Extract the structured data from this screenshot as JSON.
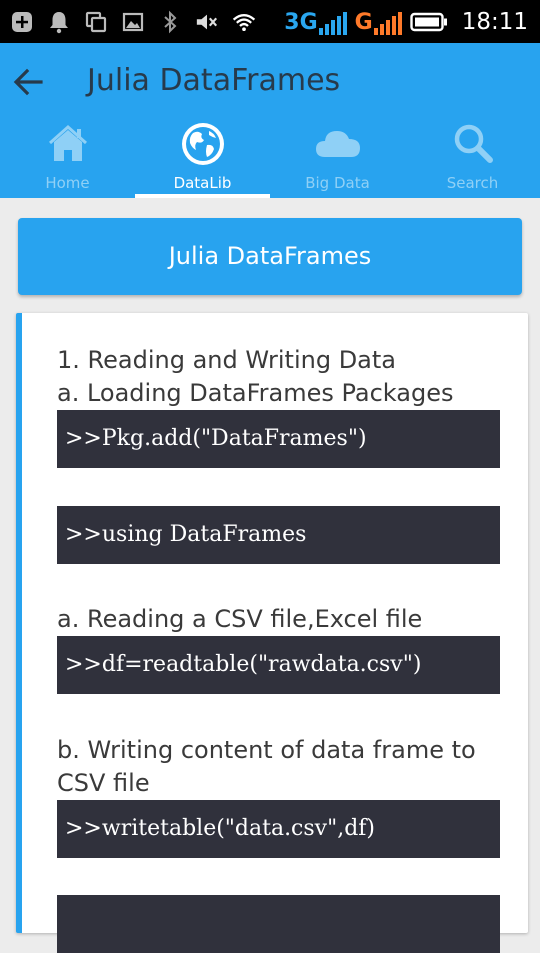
{
  "statusbar": {
    "net1": "3G",
    "net2": "G",
    "time": "18:11"
  },
  "appbar": {
    "title": "Julia DataFrames"
  },
  "tabs": [
    {
      "label": "Home",
      "icon": "home-icon",
      "active": false
    },
    {
      "label": "DataLib",
      "icon": "globe-icon",
      "active": true
    },
    {
      "label": "Big Data",
      "icon": "cloud-icon",
      "active": false
    },
    {
      "label": "Search",
      "icon": "search-icon",
      "active": false
    }
  ],
  "header": {
    "title": "Julia DataFrames"
  },
  "content": {
    "line1": "1. Reading and Writing Data",
    "line2": "a. Loading DataFrames Packages",
    "code1": ">>Pkg.add(\"DataFrames\")",
    "code2": ">>using DataFrames",
    "line3": "a. Reading a CSV file,Excel file",
    "code3": ">>df=readtable(\"rawdata.csv\")",
    "line4a": "b. Writing content of data frame to",
    "line4b": "CSV file",
    "code4": ">>writetable(\"data.csv\",df)",
    "code5": ""
  },
  "colors": {
    "primary": "#28a3ef",
    "code_bg": "#30313c",
    "title_text": "#273a4b",
    "inactive_tab": "#8fd0f6"
  }
}
